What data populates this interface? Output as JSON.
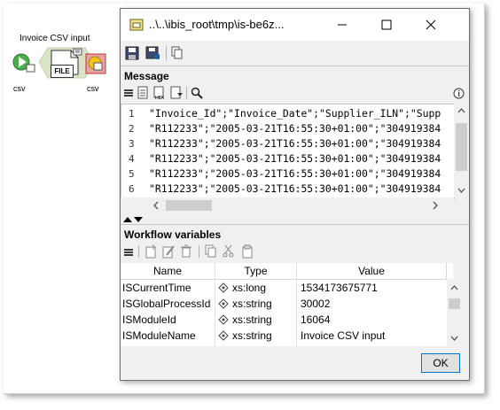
{
  "workflow": {
    "node_label": "Invoice CSV input",
    "node_badge": "FILE",
    "port_left": "csv",
    "port_right": "csv"
  },
  "dialog": {
    "title": "..\\..\\ibis_root\\tmp\\is-be6z...",
    "message_heading": "Message",
    "message_lines": [
      {
        "num": "1",
        "text": "\"Invoice_Id\";\"Invoice_Date\";\"Supplier_ILN\";\"Supp"
      },
      {
        "num": "2",
        "text": "\"R112233\";\"2005-03-21T16:55:30+01:00\";\"304919384"
      },
      {
        "num": "3",
        "text": "\"R112233\";\"2005-03-21T16:55:30+01:00\";\"304919384"
      },
      {
        "num": "4",
        "text": "\"R112233\";\"2005-03-21T16:55:30+01:00\";\"304919384"
      },
      {
        "num": "5",
        "text": "\"R112233\";\"2005-03-21T16:55:30+01:00\";\"304919384"
      },
      {
        "num": "6",
        "text": "\"R112233\";\"2005-03-21T16:55:30+01:00\";\"304919384"
      }
    ],
    "variables_heading": "Workflow variables",
    "columns": [
      "Name",
      "Type",
      "Value"
    ],
    "rows": [
      {
        "name": "ISCurrentTime",
        "type": "xs:long",
        "value": "1534173675771"
      },
      {
        "name": "ISGlobalProcessId",
        "type": "xs:string",
        "value": "30002"
      },
      {
        "name": "ISModuleId",
        "type": "xs:string",
        "value": "16064"
      },
      {
        "name": "ISModuleName",
        "type": "xs:string",
        "value": "Invoice CSV input"
      }
    ],
    "ok_label": "OK"
  },
  "icons": {
    "title": "app-window-icon",
    "minimize": "minimize-icon",
    "maximize": "maximize-icon",
    "close": "close-icon",
    "save": "save-icon",
    "save_all": "save-to-database-icon",
    "copy": "copy-icon",
    "search": "search-icon",
    "info": "info-icon"
  }
}
